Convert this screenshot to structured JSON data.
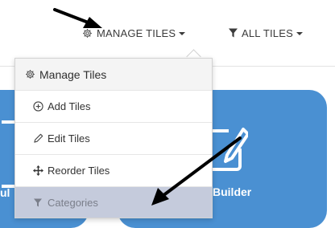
{
  "topbar": {
    "manage_tiles_label": "MANAGE TILES",
    "all_tiles_label": "ALL TILES"
  },
  "tiles": {
    "left_fragment_text": "ul",
    "builder_label": "Builder"
  },
  "dropdown": {
    "header_label": "Manage Tiles",
    "items": [
      {
        "label": "Add Tiles",
        "icon": "plus-circle-icon"
      },
      {
        "label": "Edit Tiles",
        "icon": "pencil-icon"
      },
      {
        "label": "Reorder Tiles",
        "icon": "move-arrows-icon"
      },
      {
        "label": "Categories",
        "icon": "filter-icon",
        "state": "disabled"
      }
    ]
  },
  "colors": {
    "tile_blue": "#4a90d2",
    "annotation_arrow": "#000000",
    "categories_row_bg": "#c5cbdc"
  }
}
